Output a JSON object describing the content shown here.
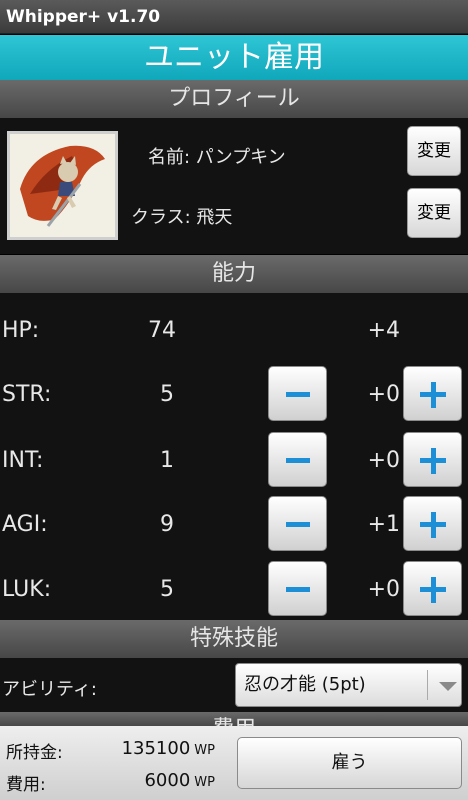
{
  "app": {
    "title": "Whipper+  v1.70"
  },
  "header": {
    "title": "ユニット雇用"
  },
  "profile": {
    "section_title": "プロフィール",
    "name_label": "名前: パンプキン",
    "class_label": "クラス: 飛天",
    "change_label": "変更"
  },
  "ability": {
    "section_title": "能力",
    "stats": [
      {
        "name": "HP:",
        "value": "74",
        "bonus": "+4"
      },
      {
        "name": "STR:",
        "value": "5",
        "bonus": "+0"
      },
      {
        "name": "INT:",
        "value": "1",
        "bonus": "+0"
      },
      {
        "name": "AGI:",
        "value": "9",
        "bonus": "+1"
      },
      {
        "name": "LUK:",
        "value": "5",
        "bonus": "+0"
      }
    ]
  },
  "skill": {
    "section_title": "特殊技能",
    "ability_label": "アビリティ:",
    "ability_value": "忍の才能 (5pt)"
  },
  "cost": {
    "section_title": "費用",
    "money_label": "所持金:",
    "money_value": "135100",
    "cost_label": "費用:",
    "cost_value": "6000",
    "unit": "WP",
    "hire_label": "雇う"
  },
  "colors": {
    "header": "#16b4c6",
    "accent": "#1c8fd6"
  }
}
